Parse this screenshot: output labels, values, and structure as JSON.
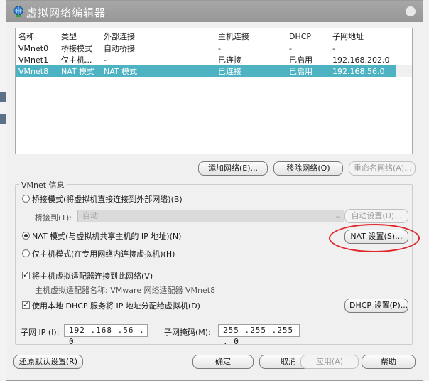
{
  "window": {
    "title": "虚拟网络编辑器"
  },
  "table": {
    "headers": [
      "名称",
      "类型",
      "外部连接",
      "主机连接",
      "DHCP",
      "子网地址"
    ],
    "rows": [
      [
        "VMnet0",
        "桥接模式",
        "自动桥接",
        "-",
        "-",
        "-"
      ],
      [
        "VMnet1",
        "仅主机...",
        "-",
        "已连接",
        "已启用",
        "192.168.202.0"
      ],
      [
        "VMnet8",
        "NAT 模式",
        "NAT 模式",
        "已连接",
        "已启用",
        "192.168.56.0"
      ]
    ],
    "selected_row": 2
  },
  "list_buttons": {
    "add": "添加网络(E)...",
    "remove": "移除网络(O)",
    "rename": "重命名网络(A)..."
  },
  "vmnet_info": {
    "group_label": "VMnet 信息",
    "bridged_label": "桥接模式(将虚拟机直接连接到外部网络)(B)",
    "bridge_to_label": "桥接到(T):",
    "bridge_to_value": "自动",
    "auto_settings": "自动设置(U)...",
    "nat_label": "NAT 模式(与虚拟机共享主机的 IP 地址)(N)",
    "nat_settings": "NAT 设置(S)...",
    "hostonly_label": "仅主机模式(在专用网络内连接虚拟机)(H)",
    "connect_adapter_label": "将主机虚拟适配器连接到此网络(V)",
    "adapter_name_label": "主机虚拟适配器名称: VMware 网络适配器 VMnet8",
    "dhcp_label": "使用本地 DHCP 服务将 IP 地址分配给虚拟机(D)",
    "dhcp_settings": "DHCP 设置(P)...",
    "subnet_ip_label": "子网 IP (I):",
    "subnet_ip_value": "192 .168 .56 . 0",
    "subnet_mask_label": "子网掩码(M):",
    "subnet_mask_value": "255 .255 .255 . 0",
    "mode": "nat",
    "connect_adapter_checked": true,
    "dhcp_checked": true
  },
  "footer": {
    "restore_defaults": "还原默认设置(R)",
    "ok": "确定",
    "cancel": "取消",
    "apply": "应用(A)",
    "help": "帮助"
  },
  "colors": {
    "selection": "#4db3c3",
    "titlebar": "#9c9c9c",
    "highlight": "#e0262a"
  }
}
